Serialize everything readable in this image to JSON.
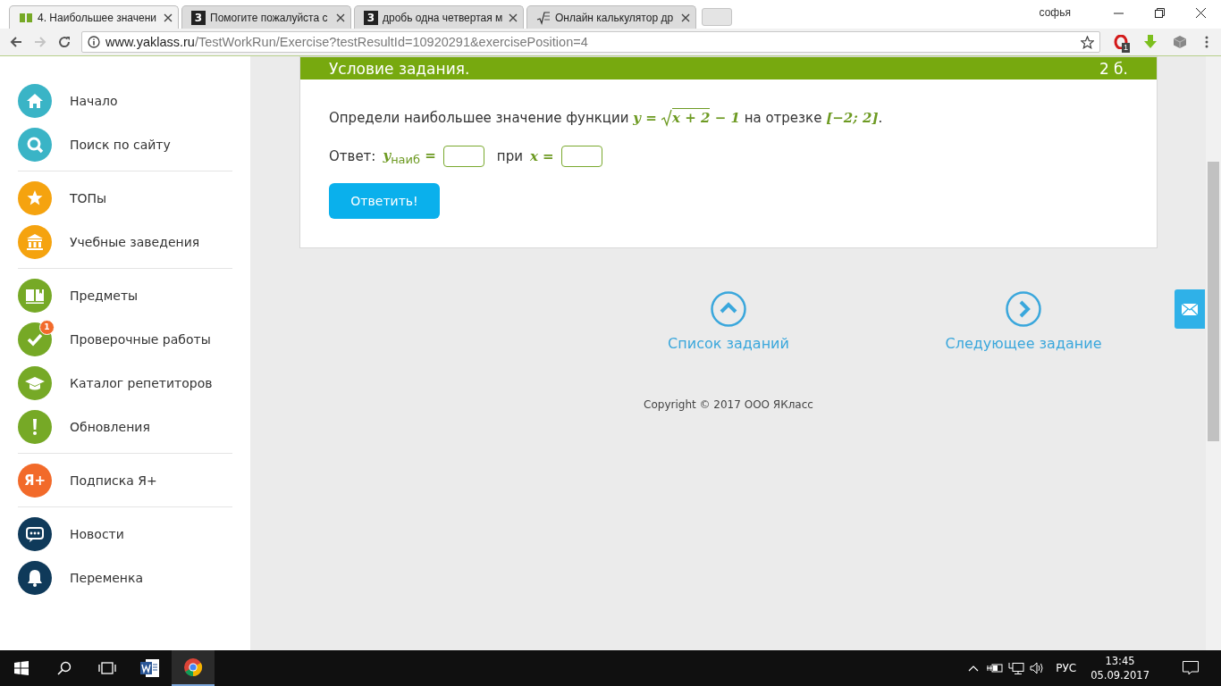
{
  "browser": {
    "tabs": [
      {
        "title": "4. Наибольшее значени",
        "kind": "bars",
        "selected": true
      },
      {
        "title": "Помогите пожалуйста с",
        "kind": "square",
        "icon_text": "3",
        "selected": false
      },
      {
        "title": "дробь одна четвертая м",
        "kind": "square",
        "icon_text": "3",
        "selected": false
      },
      {
        "title": "Онлайн калькулятор др",
        "kind": "root",
        "selected": false
      }
    ],
    "user": "софья",
    "url_host": "www.yaklass.ru",
    "url_path": "/TestWorkRun/Exercise?testResultId=10920291&exercisePosition=4",
    "extensions": [
      {
        "kind": "opera",
        "badge": "1"
      },
      {
        "kind": "download"
      },
      {
        "kind": "cube"
      }
    ]
  },
  "sidebar": {
    "groups": [
      {
        "items": [
          {
            "label": "Начало",
            "kind": "home",
            "color": "#3ab4c6"
          },
          {
            "label": "Поиск по сайту",
            "kind": "search",
            "color": "#3ab4c6"
          }
        ]
      },
      {
        "items": [
          {
            "label": "ТОПы",
            "kind": "star",
            "color": "#f5a30f"
          },
          {
            "label": "Учебные заведения",
            "kind": "building",
            "color": "#f5a30f"
          }
        ]
      },
      {
        "items": [
          {
            "label": "Предметы",
            "kind": "book",
            "color": "#76a926"
          },
          {
            "label": "Проверочные работы",
            "kind": "check",
            "color": "#76a926",
            "badge": "1"
          },
          {
            "label": "Каталог репетиторов",
            "kind": "cap",
            "color": "#76a926"
          },
          {
            "label": "Обновления",
            "kind": "exclamation",
            "color": "#76a926"
          }
        ]
      },
      {
        "items": [
          {
            "label": "Подписка Я+",
            "kind": "letters",
            "icon_text": "Я+",
            "color": "#f26a2a"
          }
        ]
      },
      {
        "items": [
          {
            "label": "Новости",
            "kind": "chat",
            "color": "#0f3a5a"
          },
          {
            "label": "Переменка",
            "kind": "bell",
            "color": "#0f3a5a"
          }
        ]
      }
    ]
  },
  "task": {
    "header_title": "Условие задания.",
    "points": "2 б.",
    "question": [
      {
        "kind": "text",
        "text": "Определи наибольшее значение функции "
      },
      {
        "kind": "math",
        "text": "y = "
      },
      {
        "kind": "sqrt",
        "text": "x + 2"
      },
      {
        "kind": "math",
        "text": " − 1"
      },
      {
        "kind": "text",
        "text": " на отрезке "
      },
      {
        "kind": "math",
        "text": "[−2; 2]"
      },
      {
        "kind": "text",
        "text": "."
      }
    ],
    "answer": [
      {
        "kind": "text",
        "text": "Ответ:"
      },
      {
        "kind": "math",
        "text": "y$_{наиб}$ ="
      },
      {
        "kind": "input"
      },
      {
        "kind": "text",
        "text": "при"
      },
      {
        "kind": "math",
        "text": "x ="
      },
      {
        "kind": "input"
      }
    ],
    "submit": "Ответить!"
  },
  "navigation": [
    {
      "label": "Список заданий",
      "kind": "up"
    },
    {
      "label": "Следующее задание",
      "kind": "right"
    }
  ],
  "copyright": "Copyright © 2017 ООО ЯКласс",
  "taskbar": {
    "apps": [
      {
        "kind": "word",
        "selected": false
      },
      {
        "kind": "chrome",
        "selected": true
      }
    ],
    "language": "РУС",
    "time": "13:45",
    "date": "05.09.2017"
  }
}
